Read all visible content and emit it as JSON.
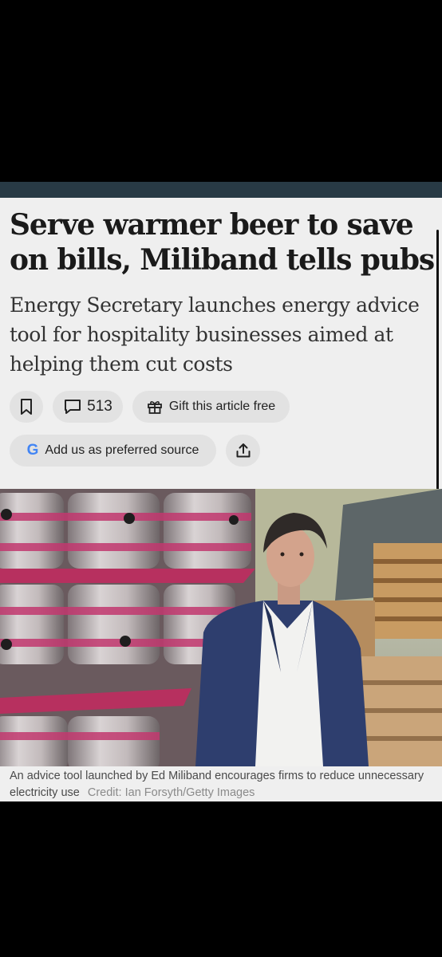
{
  "article": {
    "headline": "Serve warmer beer to save on bills, Miliband tells pubs",
    "standfirst": "Energy Secretary launches energy advice tool for hospitality businesses aimed at helping them cut costs"
  },
  "actions": {
    "comment_count": "513",
    "gift_label": "Gift this article free",
    "preferred_source_label": "Add us as preferred source",
    "preferred_source_logo": "G"
  },
  "image": {
    "caption": "An advice tool launched by Ed Miliband encourages firms to reduce unnecessary electricity use",
    "credit": "Credit: Ian Forsyth/Getty Images"
  },
  "icons": [
    "bookmark-icon",
    "comment-icon",
    "gift-icon",
    "google-g-icon",
    "share-icon"
  ],
  "colors": {
    "page_background": "#efefef",
    "header_bar": "#283a45",
    "pill_background": "#e2e2e2",
    "text": "#1a1a1a"
  }
}
